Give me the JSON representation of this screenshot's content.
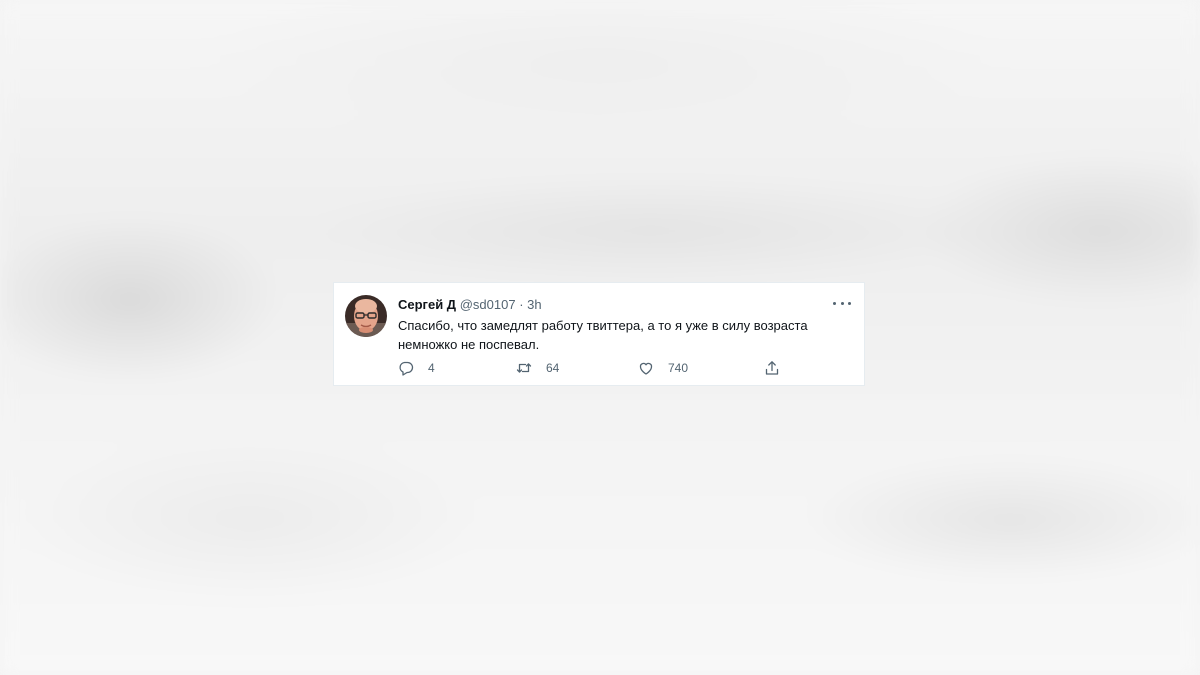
{
  "tweet": {
    "author_name": "Сергей Д",
    "author_handle": "@sd0107",
    "separator": "·",
    "time": "3h",
    "text_lines": [
      "Спасибо, что замедлят работу твиттера, а то я уже в силу возраста",
      "немножко не поспевал."
    ],
    "avatar_icon": "person-photo-avatar",
    "more_icon": "more-dots-icon"
  },
  "actions": {
    "reply": {
      "icon": "reply-bubble-icon",
      "count": "4"
    },
    "retweet": {
      "icon": "retweet-icon",
      "count": "64"
    },
    "like": {
      "icon": "heart-icon",
      "count": "740"
    },
    "share": {
      "icon": "share-icon"
    }
  },
  "colors": {
    "text_primary": "#0f1419",
    "text_secondary": "#536471",
    "card_background": "#ffffff",
    "card_border": "#e6ecf0"
  }
}
